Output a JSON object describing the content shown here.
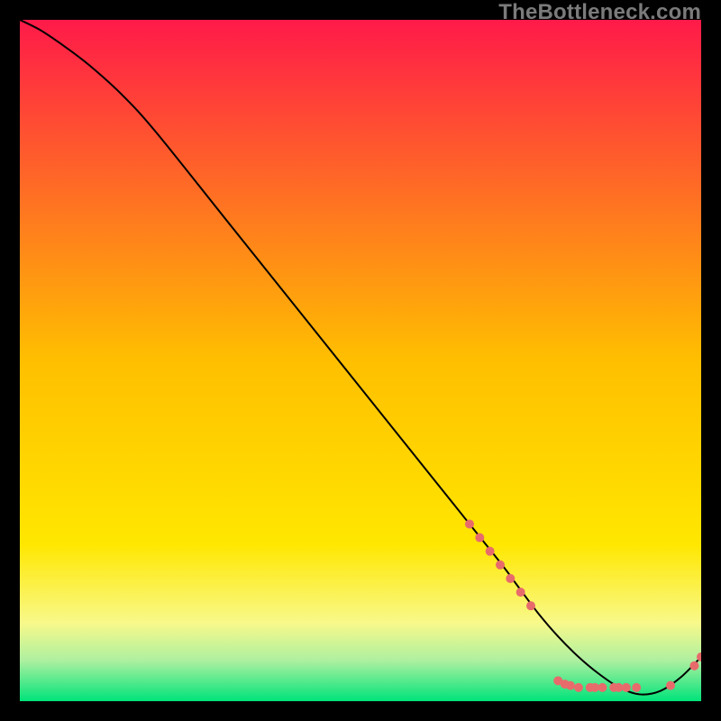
{
  "watermark": "TheBottleneck.com",
  "chart_data": {
    "type": "line",
    "title": "",
    "xlabel": "",
    "ylabel": "",
    "xlim": [
      0,
      100
    ],
    "ylim": [
      0,
      100
    ],
    "grid": false,
    "legend": false,
    "background_gradient": {
      "stops": [
        {
          "offset": 0.0,
          "color": "#ff1a49"
        },
        {
          "offset": 0.5,
          "color": "#ffbf00"
        },
        {
          "offset": 0.77,
          "color": "#ffe700"
        },
        {
          "offset": 0.885,
          "color": "#f8f98a"
        },
        {
          "offset": 0.94,
          "color": "#aef0a0"
        },
        {
          "offset": 1.0,
          "color": "#00e37a"
        }
      ]
    },
    "series": [
      {
        "name": "bottleneck-curve",
        "color": "#000000",
        "x": [
          0,
          3,
          6,
          10,
          15,
          20,
          30,
          40,
          50,
          60,
          70,
          73,
          76,
          79,
          82,
          85,
          88,
          91,
          94,
          97,
          100
        ],
        "y": [
          100,
          98.5,
          96.5,
          93.5,
          89,
          83.5,
          71,
          58.5,
          46,
          33.5,
          21,
          17,
          13,
          9.5,
          6.5,
          4,
          2,
          1,
          1.5,
          3.5,
          6.5
        ]
      }
    ],
    "scatter": [
      {
        "name": "data-points",
        "color": "#e86b6b",
        "radius": 5,
        "points": [
          {
            "x": 66,
            "y": 26
          },
          {
            "x": 67.5,
            "y": 24
          },
          {
            "x": 69,
            "y": 22
          },
          {
            "x": 70.5,
            "y": 20
          },
          {
            "x": 72,
            "y": 18
          },
          {
            "x": 73.5,
            "y": 16
          },
          {
            "x": 75,
            "y": 14
          },
          {
            "x": 79,
            "y": 3
          },
          {
            "x": 80,
            "y": 2.5
          },
          {
            "x": 80.8,
            "y": 2.3
          },
          {
            "x": 82,
            "y": 2
          },
          {
            "x": 83.7,
            "y": 2
          },
          {
            "x": 84.4,
            "y": 2
          },
          {
            "x": 85.5,
            "y": 2
          },
          {
            "x": 87.2,
            "y": 2
          },
          {
            "x": 87.9,
            "y": 2
          },
          {
            "x": 89,
            "y": 2
          },
          {
            "x": 90.5,
            "y": 2
          },
          {
            "x": 95.5,
            "y": 2.3
          },
          {
            "x": 99,
            "y": 5.2
          },
          {
            "x": 100,
            "y": 6.5
          }
        ]
      }
    ]
  }
}
